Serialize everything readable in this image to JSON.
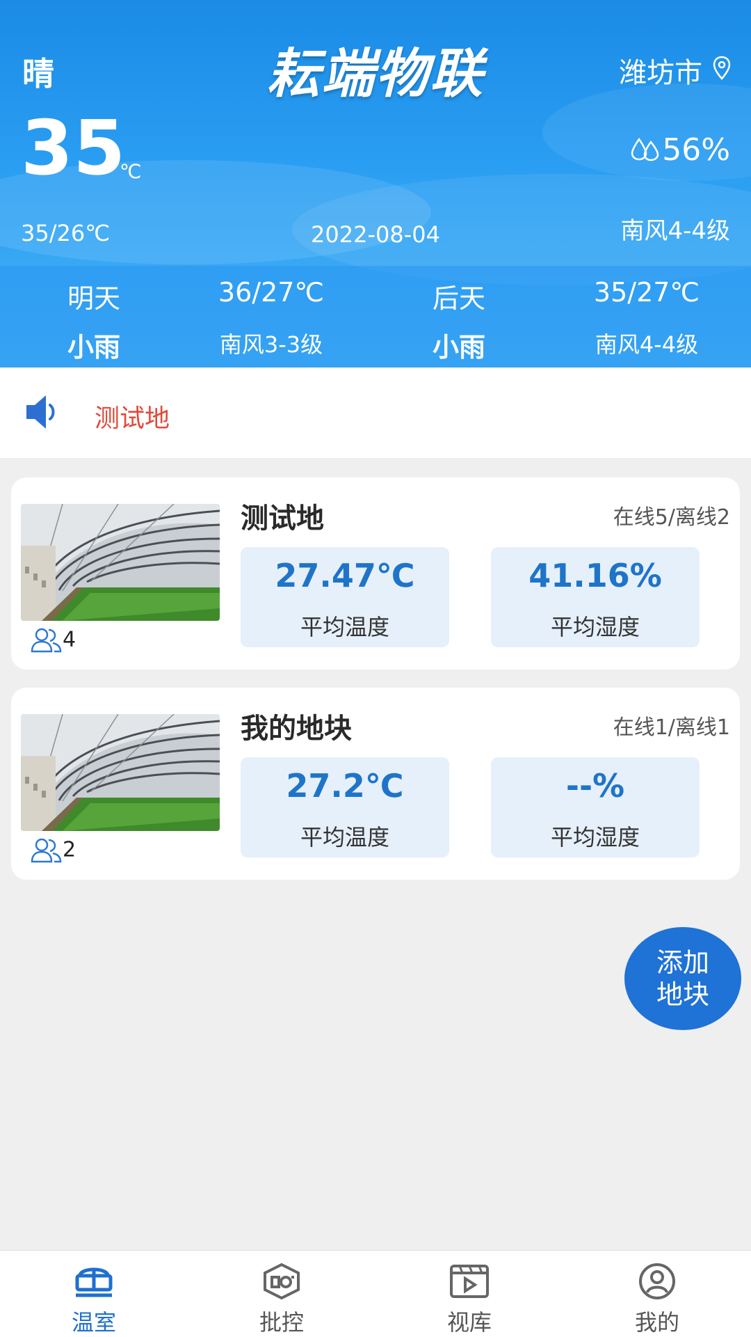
{
  "weather": {
    "condition": "晴",
    "app_title": "耘端物联",
    "city": "潍坊市",
    "temperature": "35",
    "temp_unit": "℃",
    "humidity": "56%",
    "temp_range": "35/26℃",
    "date": "2022-08-04",
    "wind": "南风4-4级",
    "forecast": [
      {
        "day": "明天",
        "temp": "36/27℃",
        "condition": "小雨",
        "wind": "南风3-3级"
      },
      {
        "day": "后天",
        "temp": "35/27℃",
        "condition": "小雨",
        "wind": "南风4-4级"
      }
    ]
  },
  "notice": {
    "text": "测试地"
  },
  "plots": [
    {
      "name": "测试地",
      "status": "在线5/离线2",
      "members": "4",
      "avg_temp": "27.47℃",
      "avg_temp_label": "平均温度",
      "avg_humidity": "41.16%",
      "avg_humidity_label": "平均湿度"
    },
    {
      "name": "我的地块",
      "status": "在线1/离线1",
      "members": "2",
      "avg_temp": "27.2℃",
      "avg_temp_label": "平均温度",
      "avg_humidity": "--%",
      "avg_humidity_label": "平均湿度"
    }
  ],
  "add_button": {
    "line1": "添加",
    "line2": "地块"
  },
  "tabs": [
    {
      "label": "温室",
      "icon": "greenhouse-icon"
    },
    {
      "label": "批控",
      "icon": "batch-control-icon"
    },
    {
      "label": "视库",
      "icon": "video-library-icon"
    },
    {
      "label": "我的",
      "icon": "profile-icon"
    }
  ],
  "colors": {
    "primary": "#1f72d6",
    "header": "#2a9ef2",
    "notice_text": "#e14a3a",
    "stat_bg": "#e6f0fb"
  }
}
